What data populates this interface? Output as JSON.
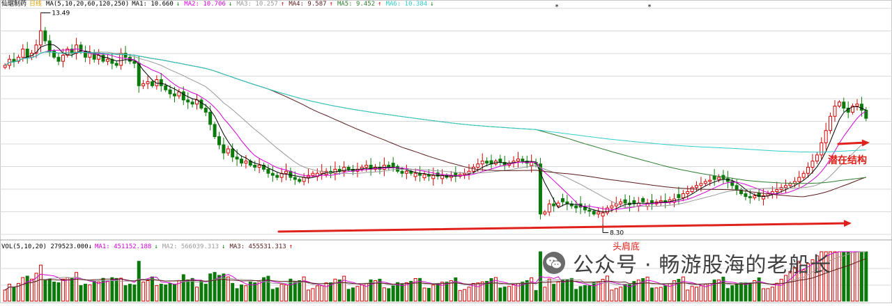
{
  "chart_data": {
    "type": "candlestick",
    "stock_name": "仙琚制药",
    "period": "日线",
    "ma_params": "MA(5,10,20,60,120,250)",
    "ma_legend": [
      {
        "label": "MA1: 10.660",
        "arrow": "↓",
        "color": "#000000"
      },
      {
        "label": "MA2: 10.706",
        "arrow": "↓",
        "color": "#d400d4"
      },
      {
        "label": "MA3: 10.257",
        "arrow": "↑",
        "color": "#999999"
      },
      {
        "label": "MA4: 9.587",
        "arrow": "↑",
        "color": "#5a1a1a"
      },
      {
        "label": "MA5: 9.452",
        "arrow": "↑",
        "color": "#2e7d2e"
      },
      {
        "label": "MA6: 10.384",
        "arrow": "↓",
        "color": "#33cccc"
      }
    ],
    "high_label": "13.49",
    "low_label": "8.30",
    "ylim": [
      8.0,
      13.6
    ],
    "closes": [
      12.2,
      12.35,
      12.3,
      12.4,
      12.6,
      12.4,
      12.5,
      12.7,
      13.05,
      12.8,
      12.55,
      12.4,
      12.3,
      12.45,
      12.6,
      12.5,
      12.7,
      12.55,
      12.4,
      12.5,
      12.35,
      12.45,
      12.3,
      12.35,
      12.25,
      12.2,
      12.5,
      12.4,
      12.3,
      12.25,
      11.7,
      11.75,
      11.8,
      11.7,
      11.85,
      11.7,
      11.6,
      11.5,
      11.45,
      11.55,
      11.35,
      11.3,
      11.25,
      11.35,
      11.15,
      11.05,
      10.75,
      10.45,
      10.25,
      10.05,
      10.15,
      9.95,
      9.9,
      9.8,
      9.85,
      9.75,
      9.7,
      9.75,
      9.65,
      9.55,
      9.5,
      9.45,
      9.55,
      9.6,
      9.45,
      9.4,
      9.35,
      9.45,
      9.5,
      9.55,
      9.55,
      9.6,
      9.6,
      9.55,
      9.65,
      9.6,
      9.7,
      9.65,
      9.6,
      9.65,
      9.7,
      9.75,
      9.65,
      9.7,
      9.65,
      9.75,
      9.7,
      9.72,
      9.6,
      9.55,
      9.6,
      9.55,
      9.55,
      9.5,
      9.52,
      9.48,
      9.5,
      9.48,
      9.5,
      9.45,
      9.5,
      9.48,
      9.52,
      9.55,
      9.6,
      9.7,
      9.78,
      9.85,
      9.8,
      9.78,
      9.85,
      9.82,
      9.75,
      9.8,
      9.85,
      9.9,
      9.85,
      9.8,
      9.82,
      9.78,
      8.55,
      8.6,
      8.8,
      8.75,
      8.82,
      8.85,
      8.8,
      8.75,
      8.7,
      8.72,
      8.65,
      8.62,
      8.55,
      8.6,
      8.58,
      8.7,
      8.75,
      8.8,
      8.85,
      8.82,
      8.78,
      8.8,
      8.82,
      8.85,
      8.82,
      8.8,
      8.85,
      8.88,
      8.85,
      8.9,
      8.92,
      8.95,
      9.05,
      9.1,
      9.2,
      9.25,
      9.3,
      9.35,
      9.38,
      9.4,
      9.45,
      9.42,
      9.35,
      9.25,
      9.15,
      9.05,
      8.98,
      8.95,
      9.0,
      8.98,
      9.0,
      9.05,
      9.1,
      9.15,
      9.2,
      9.25,
      9.3,
      9.35,
      9.45,
      9.55,
      9.7,
      9.85,
      10.0,
      10.3,
      10.6,
      10.95,
      11.2,
      11.3,
      11.15,
      11.05,
      11.2,
      11.25,
      11.1,
      10.9
    ],
    "volume_legend": "VOL(5,10,20)  279523.000↓",
    "volume_ma_legend": [
      {
        "label": "MA1: 451152.188",
        "arrow": "↓",
        "color": "#d400d4"
      },
      {
        "label": "MA2: 566039.313",
        "arrow": "↓",
        "color": "#999999"
      },
      {
        "label": "MA3: 455531.313",
        "arrow": "↑",
        "color": "#5a1a1a"
      }
    ],
    "annotations": {
      "potential_structure": "潜在结构",
      "head_shoulders_bottom": "头肩底"
    },
    "colors": {
      "up": "#d40000",
      "down": "#0a7a0a",
      "annotation": "#e0201a",
      "grid": "#d8d8d8"
    }
  },
  "watermark": {
    "account_type": "公众号",
    "separator": "·",
    "account_name": "畅游股海的老船长"
  }
}
